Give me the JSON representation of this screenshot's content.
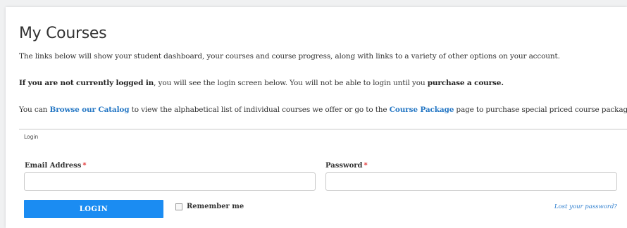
{
  "page": {
    "title": "My Courses"
  },
  "intro": {
    "p1": "The links below will show your student dashboard, your courses and course progress, along with links to a variety of other options on your account.",
    "p2_bold": "If you are not currently logged in",
    "p2_mid": ", you will see the login screen below. You will not be able to login until you ",
    "p2_bold_end": "purchase a course.",
    "p3_start": "You can ",
    "p3_link1": "Browse our Catalog",
    "p3_mid": " to view the alphabetical list of individual courses we offer or go to the ",
    "p3_link2": "Course Package",
    "p3_end": " page to purchase special priced course packages."
  },
  "login": {
    "tab_label": "Login",
    "email_label": "Email Address",
    "password_label": "Password",
    "required_mark": "*",
    "email_value": "",
    "password_value": "",
    "button_label": "LOGIN",
    "remember_label": "Remember me",
    "remember_checked": false,
    "lost_password": "Lost your password?"
  },
  "colors": {
    "accent": "#1b8cf2",
    "link": "#2577c4",
    "required": "#e02b2b"
  }
}
